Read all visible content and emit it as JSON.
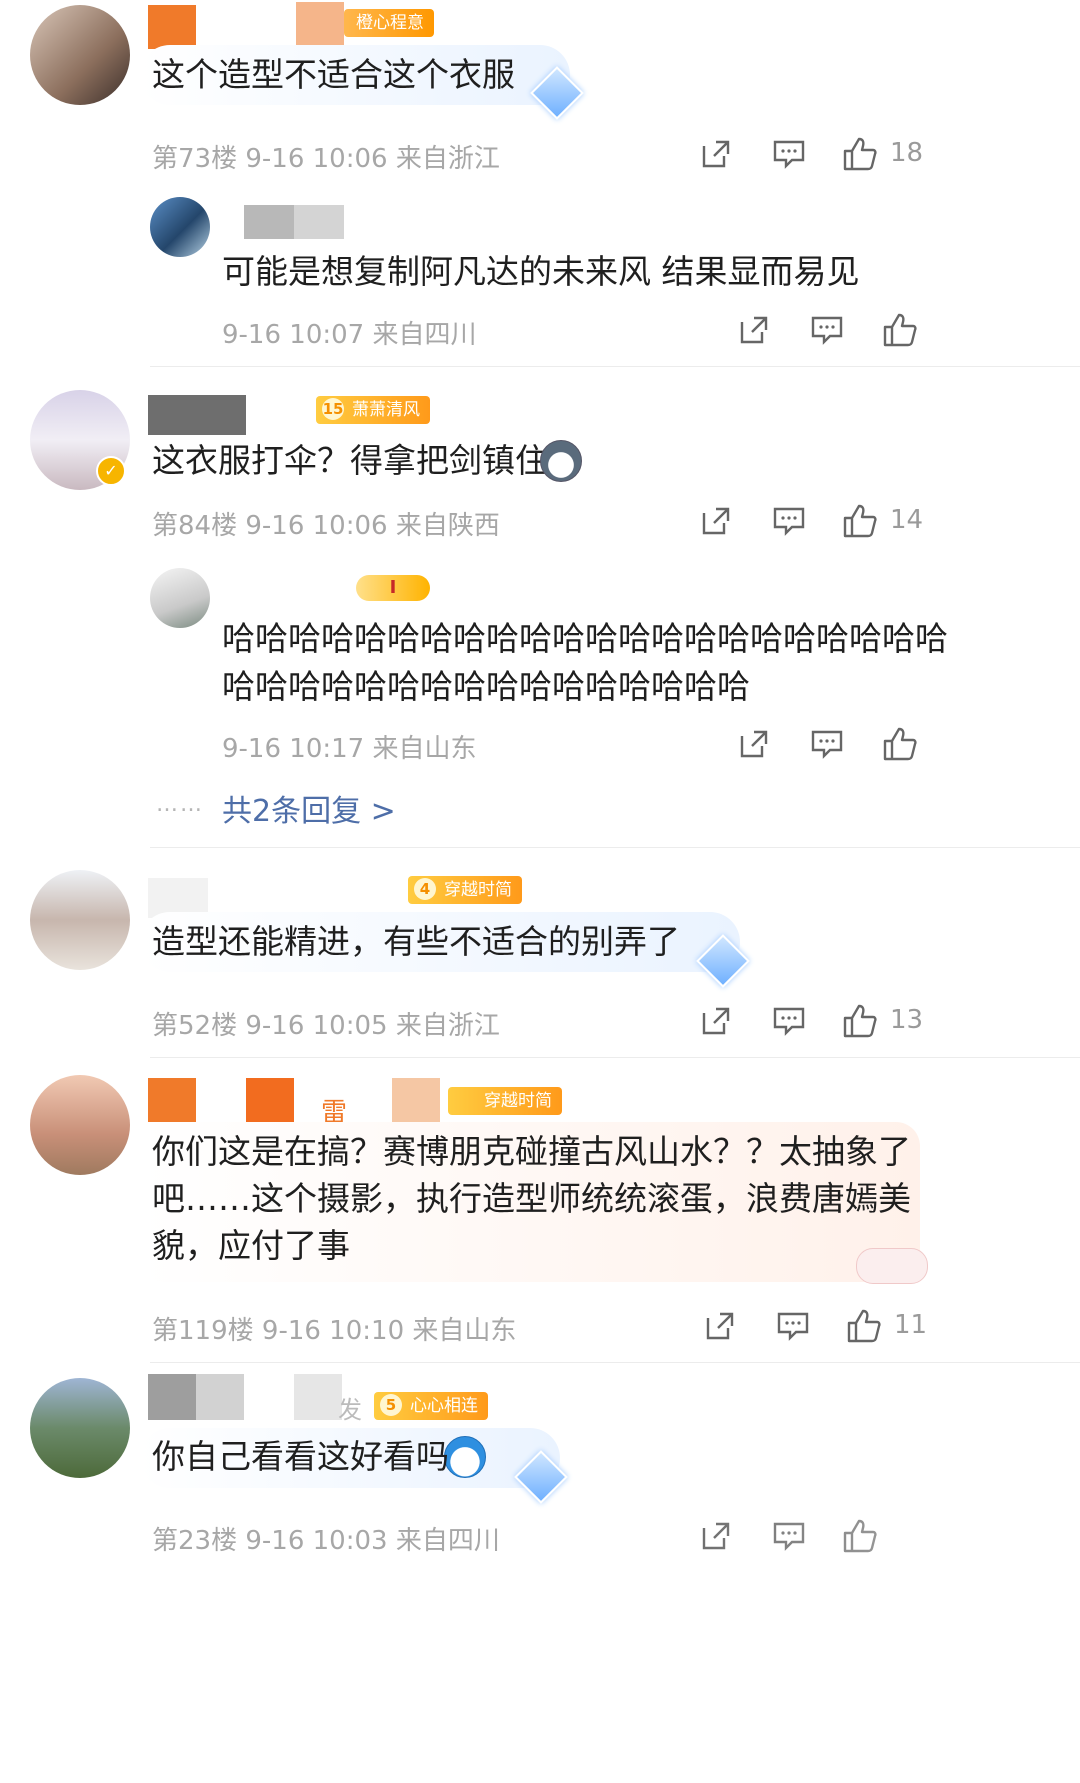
{
  "comments": [
    {
      "badge": "橙心程意",
      "text": "这个造型不适合这个衣服",
      "floor": "第73楼",
      "time": "9-16 10:06",
      "location": "来自浙江",
      "likes": "18",
      "replies": [
        {
          "text": "可能是想复制阿凡达的未来风 结果显而易见",
          "time": "9-16 10:07",
          "location": "来自四川"
        }
      ]
    },
    {
      "badge": "萧萧清风",
      "badge_level": "15",
      "text": "这衣服打伞？得拿把剑镇住",
      "floor": "第84楼",
      "time": "9-16 10:06",
      "location": "来自陕西",
      "likes": "14",
      "replies": [
        {
          "text_line1": "哈哈哈哈哈哈哈哈哈哈哈哈哈哈哈哈哈哈哈哈哈哈",
          "text_line2": "哈哈哈哈哈哈哈哈哈哈哈哈哈哈哈哈",
          "time": "9-16 10:17",
          "location": "来自山东"
        }
      ],
      "more_dots": "……",
      "more_replies": "共2条回复 >"
    },
    {
      "badge": "穿越时简",
      "badge_level": "4",
      "text": "造型还能精进，有些不适合的别弄了",
      "floor": "第52楼",
      "time": "9-16 10:05",
      "location": "来自浙江",
      "likes": "13"
    },
    {
      "badge": "穿越时简",
      "username_fragment": "_雷_",
      "text_line1": "你们这是在搞？赛博朋克碰撞古风山水？？太抽象了",
      "text_line2": "吧……这个摄影，执行造型师统统滚蛋，浪费唐嫣美",
      "text_line3": "貌，应付了事",
      "floor": "第119楼",
      "time": "9-16 10:10",
      "location": "来自山东",
      "likes": "11"
    },
    {
      "badge": "心心相连",
      "badge_level": "5",
      "username_fragment": "发",
      "text": "你自己看看这好看吗",
      "floor": "第23楼",
      "time": "9-16 10:03",
      "location": "来自四川"
    }
  ],
  "icons": {
    "share": "share-icon",
    "comment": "comment-icon",
    "like": "thumbs-up-icon"
  },
  "colors": {
    "link": "#4e6ea8",
    "meta": "#a7a7a7",
    "badge_orange": "#ffa726"
  }
}
